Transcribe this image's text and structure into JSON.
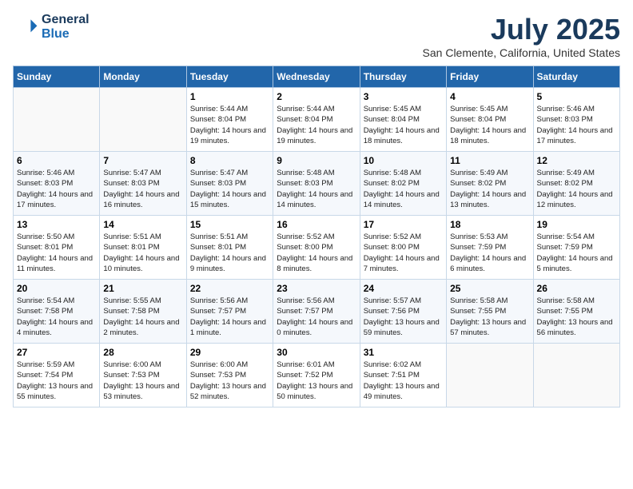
{
  "header": {
    "logo_line1": "General",
    "logo_line2": "Blue",
    "month": "July 2025",
    "location": "San Clemente, California, United States"
  },
  "weekdays": [
    "Sunday",
    "Monday",
    "Tuesday",
    "Wednesday",
    "Thursday",
    "Friday",
    "Saturday"
  ],
  "weeks": [
    [
      {
        "day": "",
        "info": ""
      },
      {
        "day": "",
        "info": ""
      },
      {
        "day": "1",
        "info": "Sunrise: 5:44 AM\nSunset: 8:04 PM\nDaylight: 14 hours and 19 minutes."
      },
      {
        "day": "2",
        "info": "Sunrise: 5:44 AM\nSunset: 8:04 PM\nDaylight: 14 hours and 19 minutes."
      },
      {
        "day": "3",
        "info": "Sunrise: 5:45 AM\nSunset: 8:04 PM\nDaylight: 14 hours and 18 minutes."
      },
      {
        "day": "4",
        "info": "Sunrise: 5:45 AM\nSunset: 8:04 PM\nDaylight: 14 hours and 18 minutes."
      },
      {
        "day": "5",
        "info": "Sunrise: 5:46 AM\nSunset: 8:03 PM\nDaylight: 14 hours and 17 minutes."
      }
    ],
    [
      {
        "day": "6",
        "info": "Sunrise: 5:46 AM\nSunset: 8:03 PM\nDaylight: 14 hours and 17 minutes."
      },
      {
        "day": "7",
        "info": "Sunrise: 5:47 AM\nSunset: 8:03 PM\nDaylight: 14 hours and 16 minutes."
      },
      {
        "day": "8",
        "info": "Sunrise: 5:47 AM\nSunset: 8:03 PM\nDaylight: 14 hours and 15 minutes."
      },
      {
        "day": "9",
        "info": "Sunrise: 5:48 AM\nSunset: 8:03 PM\nDaylight: 14 hours and 14 minutes."
      },
      {
        "day": "10",
        "info": "Sunrise: 5:48 AM\nSunset: 8:02 PM\nDaylight: 14 hours and 14 minutes."
      },
      {
        "day": "11",
        "info": "Sunrise: 5:49 AM\nSunset: 8:02 PM\nDaylight: 14 hours and 13 minutes."
      },
      {
        "day": "12",
        "info": "Sunrise: 5:49 AM\nSunset: 8:02 PM\nDaylight: 14 hours and 12 minutes."
      }
    ],
    [
      {
        "day": "13",
        "info": "Sunrise: 5:50 AM\nSunset: 8:01 PM\nDaylight: 14 hours and 11 minutes."
      },
      {
        "day": "14",
        "info": "Sunrise: 5:51 AM\nSunset: 8:01 PM\nDaylight: 14 hours and 10 minutes."
      },
      {
        "day": "15",
        "info": "Sunrise: 5:51 AM\nSunset: 8:01 PM\nDaylight: 14 hours and 9 minutes."
      },
      {
        "day": "16",
        "info": "Sunrise: 5:52 AM\nSunset: 8:00 PM\nDaylight: 14 hours and 8 minutes."
      },
      {
        "day": "17",
        "info": "Sunrise: 5:52 AM\nSunset: 8:00 PM\nDaylight: 14 hours and 7 minutes."
      },
      {
        "day": "18",
        "info": "Sunrise: 5:53 AM\nSunset: 7:59 PM\nDaylight: 14 hours and 6 minutes."
      },
      {
        "day": "19",
        "info": "Sunrise: 5:54 AM\nSunset: 7:59 PM\nDaylight: 14 hours and 5 minutes."
      }
    ],
    [
      {
        "day": "20",
        "info": "Sunrise: 5:54 AM\nSunset: 7:58 PM\nDaylight: 14 hours and 4 minutes."
      },
      {
        "day": "21",
        "info": "Sunrise: 5:55 AM\nSunset: 7:58 PM\nDaylight: 14 hours and 2 minutes."
      },
      {
        "day": "22",
        "info": "Sunrise: 5:56 AM\nSunset: 7:57 PM\nDaylight: 14 hours and 1 minute."
      },
      {
        "day": "23",
        "info": "Sunrise: 5:56 AM\nSunset: 7:57 PM\nDaylight: 14 hours and 0 minutes."
      },
      {
        "day": "24",
        "info": "Sunrise: 5:57 AM\nSunset: 7:56 PM\nDaylight: 13 hours and 59 minutes."
      },
      {
        "day": "25",
        "info": "Sunrise: 5:58 AM\nSunset: 7:55 PM\nDaylight: 13 hours and 57 minutes."
      },
      {
        "day": "26",
        "info": "Sunrise: 5:58 AM\nSunset: 7:55 PM\nDaylight: 13 hours and 56 minutes."
      }
    ],
    [
      {
        "day": "27",
        "info": "Sunrise: 5:59 AM\nSunset: 7:54 PM\nDaylight: 13 hours and 55 minutes."
      },
      {
        "day": "28",
        "info": "Sunrise: 6:00 AM\nSunset: 7:53 PM\nDaylight: 13 hours and 53 minutes."
      },
      {
        "day": "29",
        "info": "Sunrise: 6:00 AM\nSunset: 7:53 PM\nDaylight: 13 hours and 52 minutes."
      },
      {
        "day": "30",
        "info": "Sunrise: 6:01 AM\nSunset: 7:52 PM\nDaylight: 13 hours and 50 minutes."
      },
      {
        "day": "31",
        "info": "Sunrise: 6:02 AM\nSunset: 7:51 PM\nDaylight: 13 hours and 49 minutes."
      },
      {
        "day": "",
        "info": ""
      },
      {
        "day": "",
        "info": ""
      }
    ]
  ]
}
